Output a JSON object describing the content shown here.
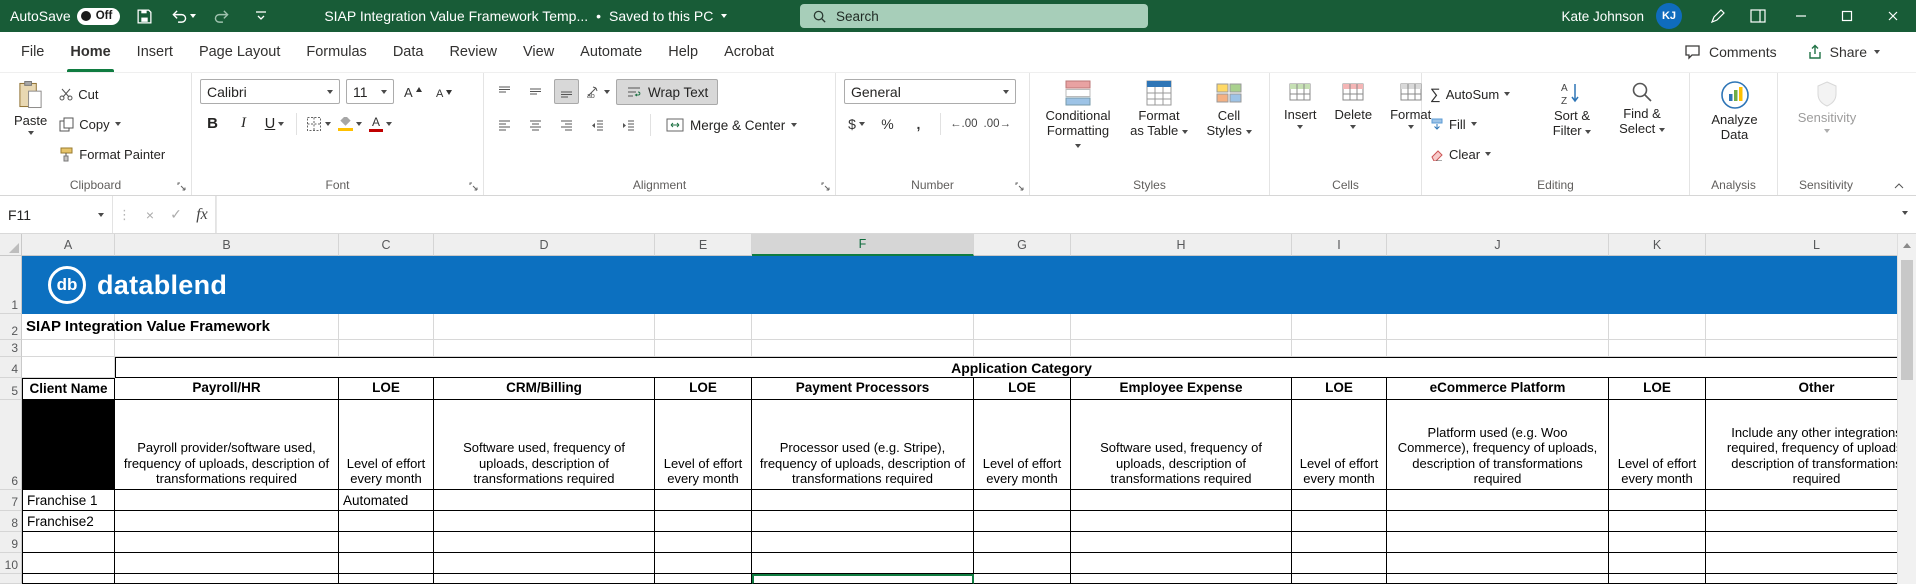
{
  "titlebar": {
    "autosave_label": "AutoSave",
    "autosave_state": "Off",
    "title": "SIAP Integration Value Framework Temp...",
    "separator": "•",
    "saved_status": "Saved to this PC",
    "search_placeholder": "Search",
    "user_name": "Kate Johnson",
    "user_initials": "KJ"
  },
  "menu": {
    "tabs": [
      {
        "label": "File",
        "active": false
      },
      {
        "label": "Home",
        "active": true
      },
      {
        "label": "Insert",
        "active": false
      },
      {
        "label": "Page Layout",
        "active": false
      },
      {
        "label": "Formulas",
        "active": false
      },
      {
        "label": "Data",
        "active": false
      },
      {
        "label": "Review",
        "active": false
      },
      {
        "label": "View",
        "active": false
      },
      {
        "label": "Automate",
        "active": false
      },
      {
        "label": "Help",
        "active": false
      },
      {
        "label": "Acrobat",
        "active": false
      }
    ],
    "comments_label": "Comments",
    "share_label": "Share"
  },
  "ribbon": {
    "clipboard": {
      "label": "Clipboard",
      "paste": "Paste",
      "cut": "Cut",
      "copy": "Copy",
      "format_painter": "Format Painter"
    },
    "font": {
      "label": "Font",
      "font_name": "Calibri",
      "font_size": "11",
      "bold": "B",
      "italic": "I",
      "underline": "U"
    },
    "alignment": {
      "label": "Alignment",
      "wrap_text": "Wrap Text",
      "merge_center": "Merge & Center"
    },
    "number": {
      "label": "Number",
      "format_value": "General",
      "currency": "$",
      "percent": "%",
      "comma": ",",
      "increase_decimal": "←.00",
      "decrease_decimal": ".00→"
    },
    "styles": {
      "label": "Styles",
      "conditional_formatting": "Conditional Formatting",
      "format_as_table": "Format as Table",
      "cell_styles": "Cell Styles"
    },
    "cells": {
      "label": "Cells",
      "insert": "Insert",
      "delete": "Delete",
      "format": "Format"
    },
    "editing": {
      "label": "Editing",
      "autosum_sigma": "∑",
      "autosum": "AutoSum",
      "fill": "Fill",
      "clear": "Clear",
      "sort_filter": "Sort & Filter",
      "find_select": "Find & Select"
    },
    "analysis": {
      "label": "Analysis",
      "analyze_data": "Analyze Data"
    },
    "sensitivity": {
      "label": "Sensitivity",
      "button": "Sensitivity"
    }
  },
  "formula_bar": {
    "name_box": "F11",
    "cancel_icon": "×",
    "enter_icon": "✓",
    "fx_label": "fx"
  },
  "sheet": {
    "brand": {
      "logo_initials": "db",
      "logo_text": "datablend"
    },
    "column_letters": [
      "A",
      "B",
      "C",
      "D",
      "E",
      "F",
      "G",
      "H",
      "I",
      "J",
      "K",
      "L"
    ],
    "selected_column": "F",
    "active_cell": "F11",
    "row_numbers": [
      "1",
      "2",
      "3",
      "4",
      "5",
      "6",
      "7",
      "8",
      "9",
      "10"
    ],
    "title": "SIAP Integration Value Framework",
    "application_category": "Application Category",
    "headers": {
      "A": "Client Name",
      "B": "Payroll/HR",
      "C": "LOE",
      "D": "CRM/Billing",
      "E": "LOE",
      "F": "Payment Processors",
      "G": "LOE",
      "H": "Employee Expense",
      "I": "LOE",
      "J": "eCommerce Platform",
      "K": "LOE",
      "L": "Other"
    },
    "descriptions": {
      "B": "Payroll provider/software used, frequency of uploads, description of transformations required",
      "C": "Level of effort every month",
      "D": "Software used, frequency of uploads, description of transformations required",
      "E": "Level of effort every month",
      "F": "Processor used (e.g. Stripe), frequency of uploads, description of transformations required",
      "G": "Level of effort every month",
      "H": "Software used, frequency of uploads, description of transformations required",
      "I": "Level of effort every month",
      "J": "Platform used (e.g. Woo Commerce), frequency of uploads, description of transformations required",
      "K": "Level of effort every month",
      "L": "Include any other integrations required, frequency of uploads, description of transformations required"
    },
    "data_rows": [
      {
        "row": "7",
        "cells": {
          "A": "Franchise 1",
          "C": "Automated"
        }
      },
      {
        "row": "8",
        "cells": {
          "A": "Franchise2"
        }
      }
    ]
  },
  "colors": {
    "titlebar_green": "#185C37",
    "accent_green": "#107C41",
    "banner_blue": "#0C70C0",
    "header_selected_fill": "#D6D6D6",
    "black_cell": "#000000"
  }
}
